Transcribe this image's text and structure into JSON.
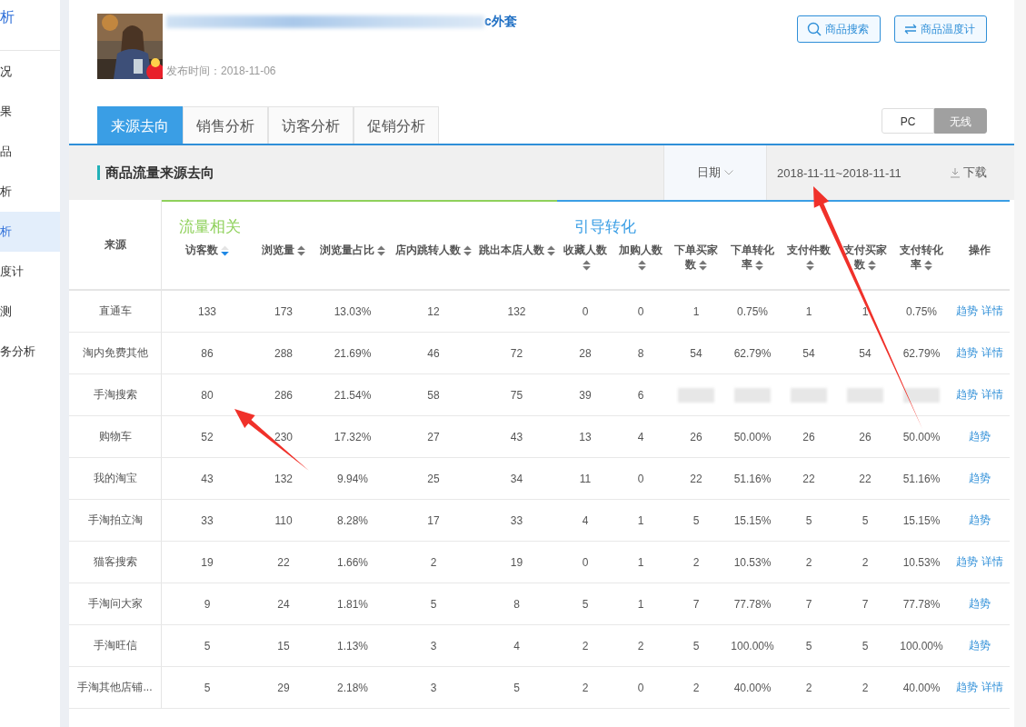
{
  "sidebar": {
    "header": "析",
    "items": [
      {
        "label": "况",
        "selected": false
      },
      {
        "label": "果",
        "selected": false
      },
      {
        "label": "品",
        "selected": false
      },
      {
        "label": "析",
        "selected": false
      },
      {
        "label": "析",
        "selected": true
      },
      {
        "label": "度计",
        "selected": false
      },
      {
        "label": "测",
        "selected": false
      },
      {
        "label": "务分析",
        "selected": false
      }
    ]
  },
  "product": {
    "title": "c外套",
    "title_blurred": true,
    "publish_time": "发布时间：2018-11-06"
  },
  "header_buttons": [
    {
      "label": "商品搜索",
      "kind": "search"
    },
    {
      "label": "商品温度计",
      "kind": "swap"
    }
  ],
  "tabs": [
    {
      "label": "来源去向",
      "selected": true
    },
    {
      "label": "销售分析",
      "selected": false
    },
    {
      "label": "访客分析",
      "selected": false
    },
    {
      "label": "促销分析",
      "selected": false
    }
  ],
  "platform_toggle": [
    {
      "label": "PC",
      "selected": false
    },
    {
      "label": "无线",
      "selected": true
    }
  ],
  "section": {
    "title": "商品流量来源去向",
    "date_filter": "日期",
    "date_range": "2018-11-11~2018-11-11",
    "download": "下载"
  },
  "table": {
    "source_header": "来源",
    "groups": [
      {
        "title": "流量相关",
        "color": "#8fd15b",
        "columns": [
          {
            "label": "访客数",
            "sortable": true,
            "sorted": true
          },
          {
            "label": "浏览量",
            "sortable": true,
            "sorted": false
          },
          {
            "label": "浏览量占比",
            "sortable": true,
            "sorted": false
          },
          {
            "label": "店内跳转人数",
            "sortable": true,
            "sorted": false
          },
          {
            "label": "跳出本店人数",
            "sortable": true,
            "sorted": false
          }
        ]
      },
      {
        "title": "引导转化",
        "color": "#3a9ee5",
        "columns": [
          {
            "label": "收藏人数",
            "sortable": true,
            "sorted": false
          },
          {
            "label": "加购人数",
            "sortable": true,
            "sorted": false
          },
          {
            "label": "下单买家数",
            "sortable": true,
            "sorted": false
          },
          {
            "label": "下单转化率",
            "sortable": true,
            "sorted": false
          },
          {
            "label": "支付件数",
            "sortable": true,
            "sorted": false
          },
          {
            "label": "支付买家数",
            "sortable": true,
            "sorted": false
          },
          {
            "label": "支付转化率",
            "sortable": true,
            "sorted": false
          },
          {
            "label": "操作",
            "sortable": false
          }
        ]
      }
    ],
    "rows": [
      {
        "source": "直通车",
        "cells": [
          "133",
          "173",
          "13.03%",
          "12",
          "132",
          "0",
          "0",
          "1",
          "0.75%",
          "1",
          "1",
          "0.75%"
        ],
        "actions": [
          "趋势",
          "详情"
        ]
      },
      {
        "source": "淘内免费其他",
        "cells": [
          "86",
          "288",
          "21.69%",
          "46",
          "72",
          "28",
          "8",
          "54",
          "62.79%",
          "54",
          "54",
          "62.79%"
        ],
        "actions": [
          "趋势",
          "详情"
        ]
      },
      {
        "source": "手淘搜索",
        "cells": [
          "80",
          "286",
          "21.54%",
          "58",
          "75",
          "39",
          "6",
          null,
          null,
          null,
          null,
          null
        ],
        "actions": [
          "趋势",
          "详情"
        ]
      },
      {
        "source": "购物车",
        "cells": [
          "52",
          "230",
          "17.32%",
          "27",
          "43",
          "13",
          "4",
          "26",
          "50.00%",
          "26",
          "26",
          "50.00%"
        ],
        "actions": [
          "趋势"
        ]
      },
      {
        "source": "我的淘宝",
        "cells": [
          "43",
          "132",
          "9.94%",
          "25",
          "34",
          "11",
          "0",
          "22",
          "51.16%",
          "22",
          "22",
          "51.16%"
        ],
        "actions": [
          "趋势"
        ]
      },
      {
        "source": "手淘拍立淘",
        "cells": [
          "33",
          "110",
          "8.28%",
          "17",
          "33",
          "4",
          "1",
          "5",
          "15.15%",
          "5",
          "5",
          "15.15%"
        ],
        "actions": [
          "趋势"
        ]
      },
      {
        "source": "猫客搜索",
        "cells": [
          "19",
          "22",
          "1.66%",
          "2",
          "19",
          "0",
          "1",
          "2",
          "10.53%",
          "2",
          "2",
          "10.53%"
        ],
        "actions": [
          "趋势",
          "详情"
        ]
      },
      {
        "source": "手淘问大家",
        "cells": [
          "9",
          "24",
          "1.81%",
          "5",
          "8",
          "5",
          "1",
          "7",
          "77.78%",
          "7",
          "7",
          "77.78%"
        ],
        "actions": [
          "趋势"
        ]
      },
      {
        "source": "手淘旺信",
        "cells": [
          "5",
          "15",
          "1.13%",
          "3",
          "4",
          "2",
          "2",
          "5",
          "100.00%",
          "5",
          "5",
          "100.00%"
        ],
        "actions": [
          "趋势"
        ]
      },
      {
        "source": "手淘其他店铺...",
        "cells": [
          "5",
          "29",
          "2.18%",
          "3",
          "5",
          "2",
          "0",
          "2",
          "40.00%",
          "2",
          "2",
          "40.00%"
        ],
        "actions": [
          "趋势",
          "详情"
        ]
      }
    ]
  },
  "annotations": [
    {
      "kind": "arrow"
    },
    {
      "kind": "arrow"
    }
  ]
}
